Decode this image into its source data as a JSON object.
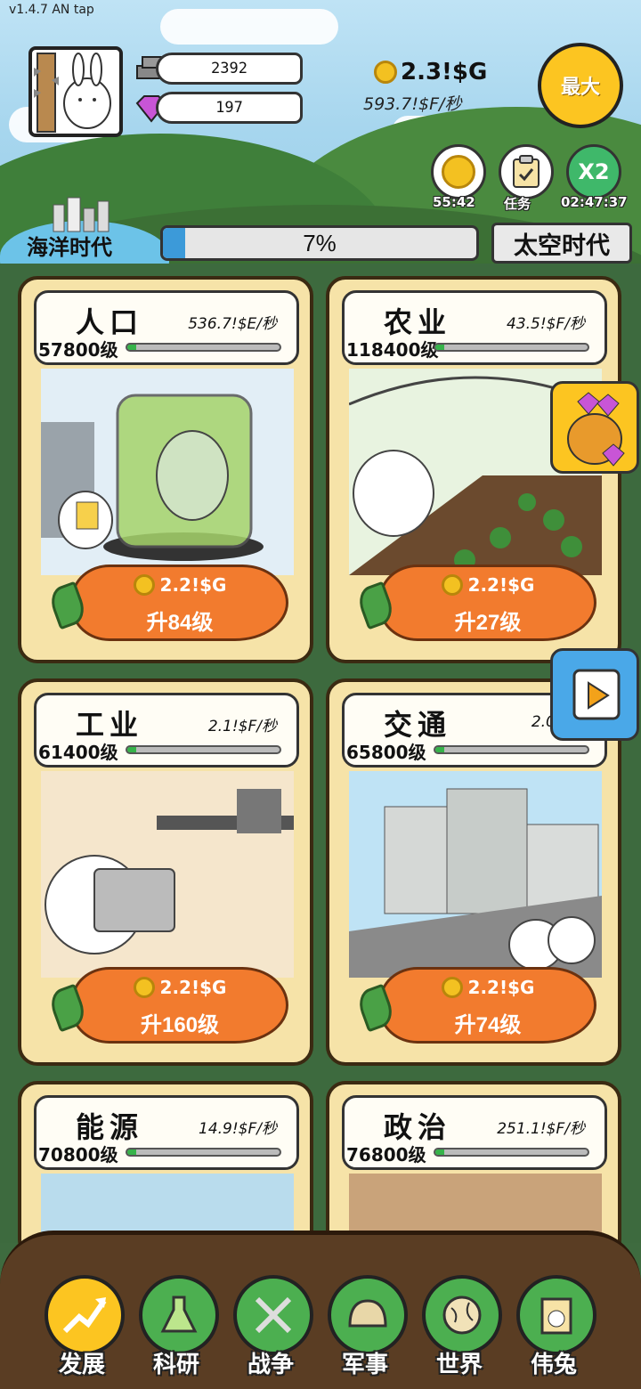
{
  "version": "v1.4.7 AN tap",
  "resources": {
    "stone": "2392",
    "gem": "197"
  },
  "gold": {
    "total": "2.3!$G",
    "rate": "593.7!$F/秒"
  },
  "max_button": "最大",
  "quick_buttons": [
    {
      "label": "55:42"
    },
    {
      "label": "任务"
    },
    {
      "label": "02:47:37",
      "badge": "X2"
    }
  ],
  "era": {
    "current": "海洋时代",
    "progress_text": "7%",
    "progress": 0.07,
    "next": "太空时代"
  },
  "cards": [
    {
      "title": "人口",
      "rate": "536.7!$E/秒",
      "level": "57800级",
      "price": "2.2!$G",
      "upgrade": "升84级"
    },
    {
      "title": "农业",
      "rate": "43.5!$F/秒",
      "level": "118400级",
      "price": "2.2!$G",
      "upgrade": "升27级"
    },
    {
      "title": "工业",
      "rate": "2.1!$F/秒",
      "level": "61400级",
      "price": "2.2!$G",
      "upgrade": "升160级"
    },
    {
      "title": "交通",
      "rate": "2.0!$F/",
      "level": "65800级",
      "price": "2.2!$G",
      "upgrade": "升74级"
    },
    {
      "title": "能源",
      "rate": "14.9!$F/秒",
      "level": "70800级"
    },
    {
      "title": "政治",
      "rate": "251.1!$F/秒",
      "level": "76800级"
    }
  ],
  "nav": [
    {
      "label": "发展",
      "color": "#fcc521"
    },
    {
      "label": "科研",
      "color": "#4caf50"
    },
    {
      "label": "战争",
      "color": "#4caf50"
    },
    {
      "label": "军事",
      "color": "#4caf50"
    },
    {
      "label": "世界",
      "color": "#4caf50"
    },
    {
      "label": "伟兔",
      "color": "#4caf50"
    }
  ]
}
